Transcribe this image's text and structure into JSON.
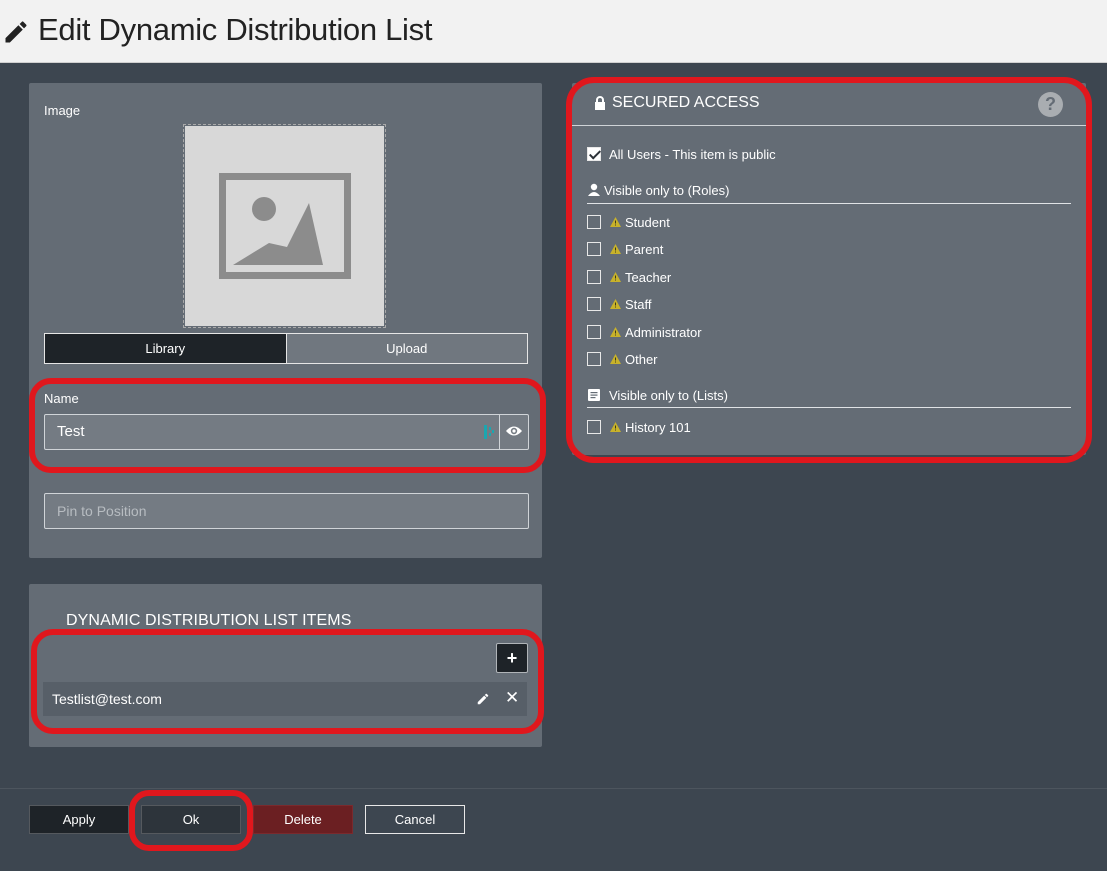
{
  "header": {
    "title": "Edit Dynamic Distribution List",
    "icon": "pencil-icon"
  },
  "image_panel": {
    "image_label": "Image",
    "tabs": [
      {
        "label": "Library",
        "active": true
      },
      {
        "label": "Upload",
        "active": false
      }
    ],
    "name_label": "Name",
    "name_value": "Test",
    "pin_placeholder": "Pin to Position"
  },
  "items_panel": {
    "title": "DYNAMIC DISTRIBUTION LIST ITEMS",
    "add_label": "+",
    "items": [
      {
        "text": "Testlist@test.com"
      }
    ],
    "remove_label": "✕"
  },
  "secured_access": {
    "title": "SECURED ACCESS",
    "help_label": "?",
    "all_users_label": "All Users - This item is public",
    "all_users_checked": true,
    "roles_heading": "Visible only to (Roles)",
    "roles": [
      {
        "label": "Student",
        "checked": false
      },
      {
        "label": "Parent",
        "checked": false
      },
      {
        "label": "Teacher",
        "checked": false
      },
      {
        "label": "Staff",
        "checked": false
      },
      {
        "label": "Administrator",
        "checked": false
      },
      {
        "label": "Other",
        "checked": false
      }
    ],
    "lists_heading": "Visible only to (Lists)",
    "lists": [
      {
        "label": "History 101",
        "checked": false
      }
    ]
  },
  "footer": {
    "apply_label": "Apply",
    "ok_label": "Ok",
    "delete_label": "Delete",
    "cancel_label": "Cancel"
  },
  "colors": {
    "highlight": "#e0171d",
    "panel": "#646c75",
    "background": "#3d4650",
    "warning": "#c8b22a",
    "delete": "#6b1f22"
  }
}
